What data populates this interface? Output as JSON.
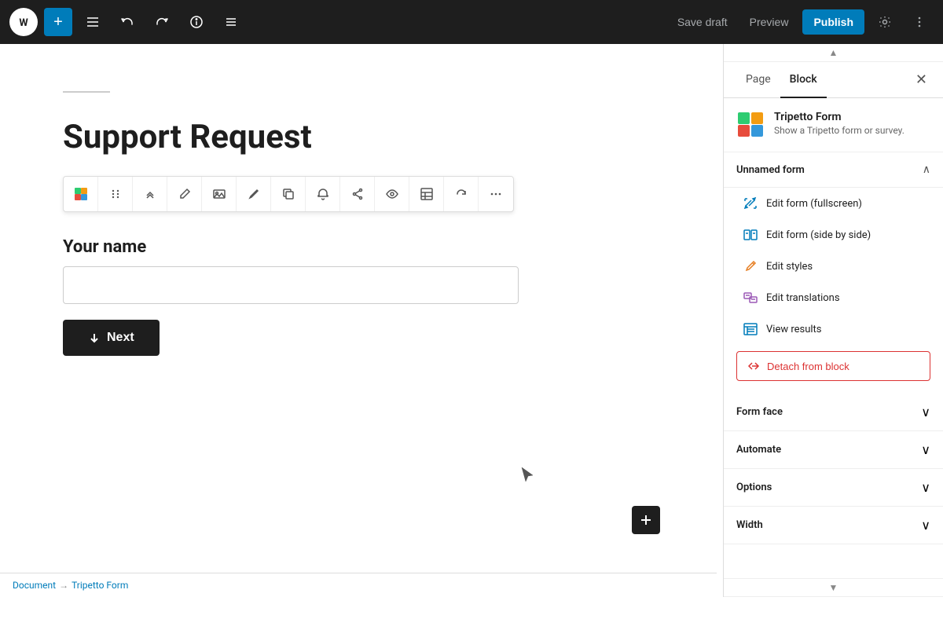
{
  "toolbar": {
    "add_label": "+",
    "save_draft_label": "Save draft",
    "preview_label": "Preview",
    "publish_label": "Publish"
  },
  "editor": {
    "post_title": "Support Request",
    "form_label": "Your name",
    "form_input_placeholder": "",
    "next_button_label": "Next"
  },
  "sidebar": {
    "page_tab": "Page",
    "block_tab": "Block",
    "plugin_name": "Tripetto Form",
    "plugin_desc": "Show a Tripetto form or survey.",
    "form_section_title": "Unnamed form",
    "menu_items": [
      {
        "label": "Edit form (fullscreen)",
        "icon": "✏️"
      },
      {
        "label": "Edit form (side by side)",
        "icon": "⊞"
      },
      {
        "label": "Edit styles",
        "icon": "🎨"
      },
      {
        "label": "Edit translations",
        "icon": "🌐"
      },
      {
        "label": "View results",
        "icon": "📋"
      }
    ],
    "detach_label": "Detach from block",
    "collapsible_sections": [
      "Form face",
      "Automate",
      "Options",
      "Width"
    ]
  },
  "breadcrumb": {
    "document_label": "Document",
    "separator": "→",
    "block_label": "Tripetto Form"
  },
  "icons": {
    "wp_logo": "W",
    "pencil": "✏",
    "undo": "↩",
    "redo": "↪",
    "info": "ℹ",
    "list": "≡",
    "close": "✕",
    "chevron_down": "∨",
    "chevron_up": "∧",
    "next_arrow": "↓",
    "plus": "+"
  }
}
